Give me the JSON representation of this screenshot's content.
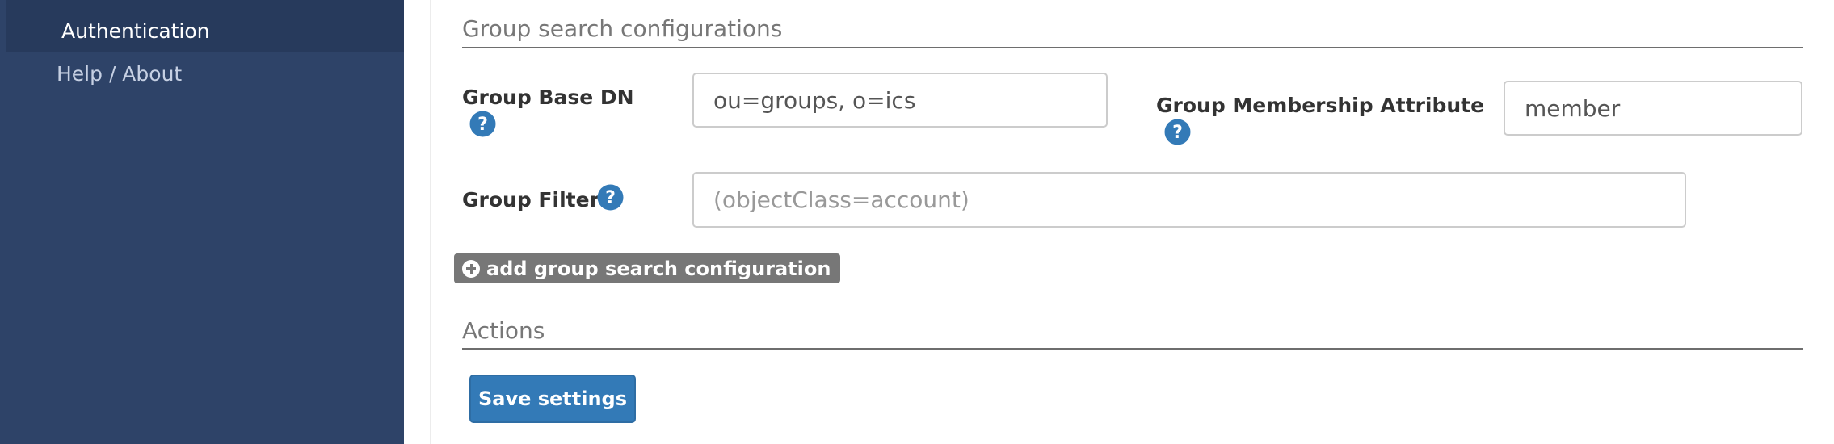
{
  "sidebar": {
    "active_item": "Authentication",
    "items": [
      {
        "label": "Help / About"
      }
    ]
  },
  "group_search": {
    "title": "Group search configurations",
    "base_dn": {
      "label": "Group Base DN",
      "value": "ou=groups, o=ics"
    },
    "membership_attribute": {
      "label": "Group Membership Attribute",
      "value": "member"
    },
    "filter": {
      "label": "Group Filter",
      "value": "",
      "placeholder": "(objectClass=account)"
    },
    "add_button_label": "add group search configuration"
  },
  "actions": {
    "title": "Actions",
    "save_label": "Save settings"
  },
  "colors": {
    "sidebar_bg": "#2e4368",
    "primary_button": "#337ab7",
    "help_icon": "#337ab7",
    "add_button": "#777777"
  },
  "icons": [
    "help-icon",
    "plus-circle-icon"
  ]
}
